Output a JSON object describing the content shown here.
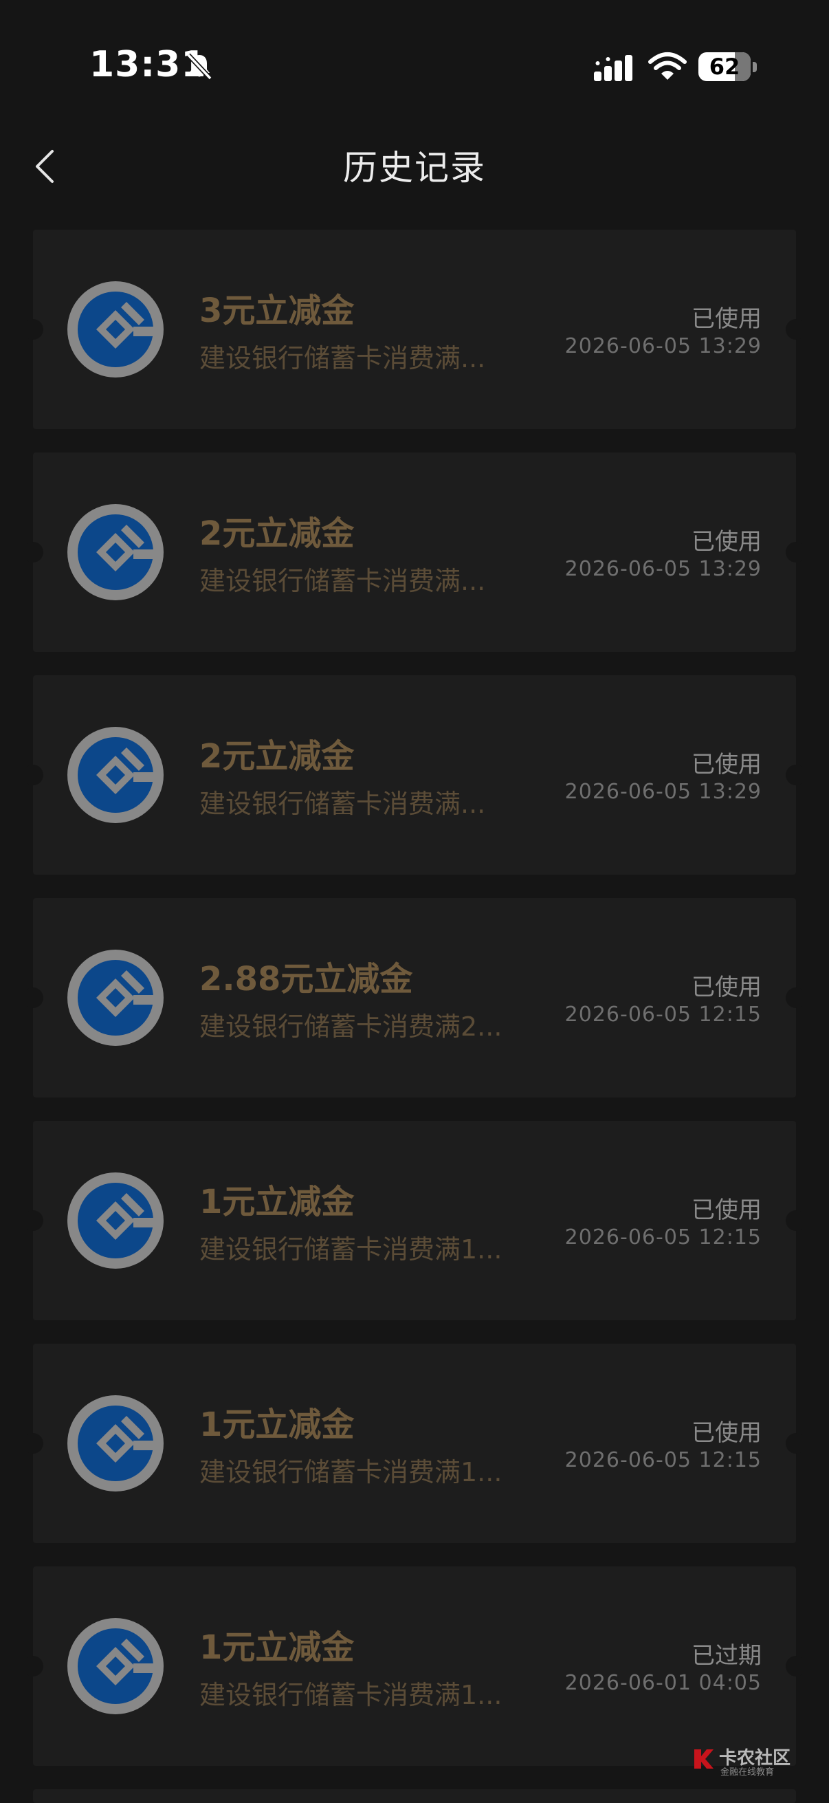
{
  "status_bar": {
    "time": "13:31",
    "battery": "62"
  },
  "header": {
    "title": "历史记录"
  },
  "coupons": [
    {
      "title": "3元立减金",
      "desc": "建设银行储蓄卡消费满...",
      "status": "已使用",
      "date": "2026-06-05 13:29"
    },
    {
      "title": "2元立减金",
      "desc": "建设银行储蓄卡消费满...",
      "status": "已使用",
      "date": "2026-06-05 13:29"
    },
    {
      "title": "2元立减金",
      "desc": "建设银行储蓄卡消费满...",
      "status": "已使用",
      "date": "2026-06-05 13:29"
    },
    {
      "title": "2.88元立减金",
      "desc": "建设银行储蓄卡消费满2...",
      "status": "已使用",
      "date": "2026-06-05 12:15"
    },
    {
      "title": "1元立减金",
      "desc": "建设银行储蓄卡消费满1...",
      "status": "已使用",
      "date": "2026-06-05 12:15"
    },
    {
      "title": "1元立减金",
      "desc": "建设银行储蓄卡消费满1...",
      "status": "已使用",
      "date": "2026-06-05 12:15"
    },
    {
      "title": "1元立减金",
      "desc": "建设银行储蓄卡消费满1...",
      "status": "已过期",
      "date": "2026-06-01 04:05"
    }
  ],
  "watermark": {
    "main": "卡农社区",
    "sub": "金融在线教育"
  },
  "icons": {
    "back": "chevron-left-icon",
    "bell": "bell-slash-icon",
    "signal": "cellular-signal-icon",
    "wifi": "wifi-icon",
    "bank_logo": "ccb-bank-logo-icon"
  },
  "colors": {
    "background": "#151515",
    "card": "#1d1d1d",
    "title_gold": "#6f5a3c",
    "desc_gold": "#5b4c37",
    "bank_blue": "#0a4f9e"
  }
}
